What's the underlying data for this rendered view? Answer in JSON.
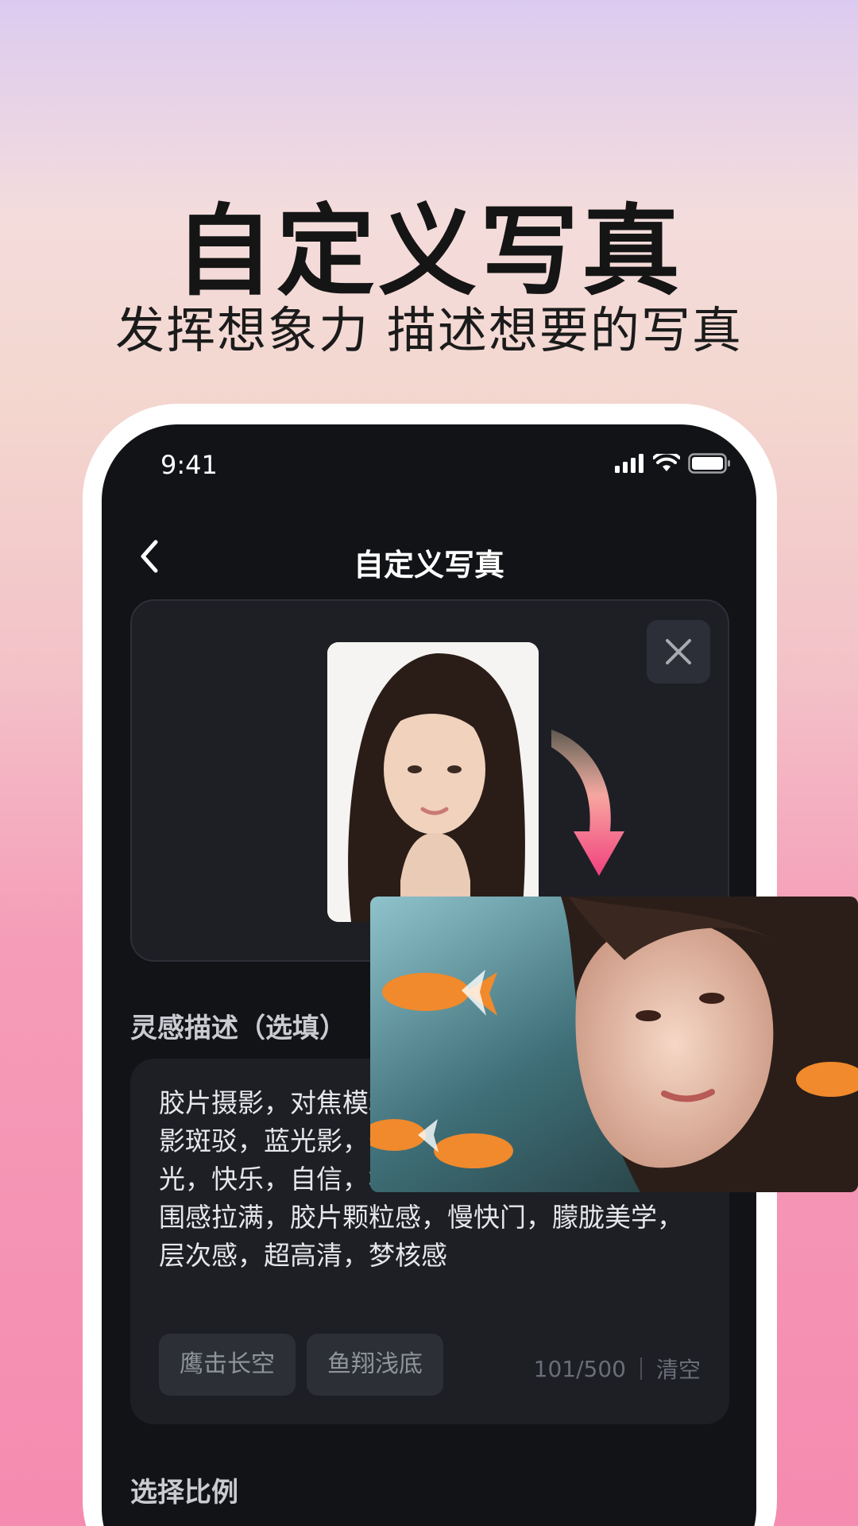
{
  "promo": {
    "headline": "自定义写真",
    "subline": "发挥想象力 描述想要的写真"
  },
  "status_bar": {
    "time": "9:41",
    "icons": [
      "signal-icon",
      "wifi-icon",
      "battery-icon"
    ]
  },
  "nav": {
    "title": "自定义写真",
    "back_icon": "chevron-left-icon"
  },
  "upload": {
    "close_icon": "close-icon",
    "arrow_icon": "curved-arrow-icon"
  },
  "description": {
    "label": "灵感描述（选填）",
    "text": "胶片摄影，对焦模糊，高对比，清透干净，光影斑驳，蓝光影，长发女生，眼神坚定，阳光，快乐，自信，松弛感，肌理质感，情绪氛围感拉满，胶片颗粒感，慢快门，朦胧美学，层次感，超高清，梦核感",
    "chips": [
      "鹰击长空",
      "鱼翔浅底"
    ],
    "counter": "101/500",
    "clear_label": "清空"
  },
  "ratio": {
    "label": "选择比例"
  },
  "colors": {
    "screen_bg": "#121317",
    "card_bg": "#1d1f25",
    "arrow_start": "#f9d3a8",
    "arrow_end": "#f2407e"
  }
}
